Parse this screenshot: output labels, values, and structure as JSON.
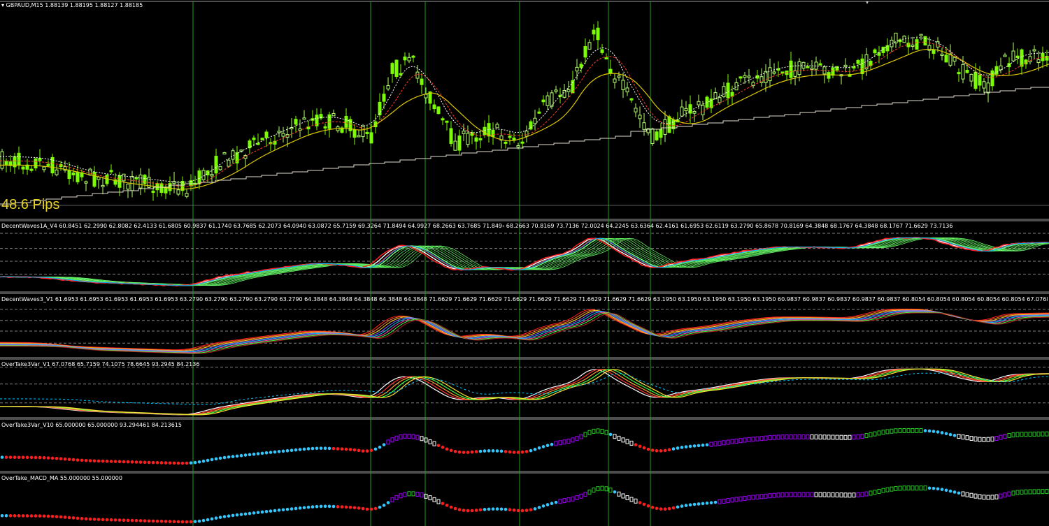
{
  "window": {
    "symbol_header": "▾ GBPAUD,M15  1.88139 1.88195 1.88127 1.88185",
    "pips_label": "48.6 Pips",
    "collapse_icon": "▾"
  },
  "indicators": [
    {
      "id": "dw1a",
      "label": "DecentWaves1A_V4 60.8451 62.2990 62.8082 62.4133 61.6805 60.9837 61.1740 63.7685 62.2073 64.0940 63.0872 65.7159 69.3264 71.8494 64.9927 68.2663 63.7685 71.849‹ 68.2663 70.8169 73.7136 72.0024 64.2245 63.6364 62.4161 61.6953 62.6119 63.2790 65.8678 70.8169 64.3848 68.1767 64.3848 68.1767 71.6629 73.7136"
    },
    {
      "id": "dw3",
      "label": "DecentWaves3_V1 61.6953 61.6953 61.6953 61.6953 61.6953 63.2790 63.2790 63.2790 63.2790 63.2790 64.3848 64.3848 64.3848 64.3848 64.3848 71.6629 71.6629 71.6629 71.6629 71.6629 71.6629 71.6629 71.6629 71.6629 63.1950 63.1950 63.1950 63.1950 63.1950 60.9837 60.9837 60.9837 60.9837 60.9837 60.8054 60.8054 60.8054 60.8054 60.8054 67.0768 67.0768 67.0768 67.0768 67.0768 67.07"
    },
    {
      "id": "ot3v1",
      "label": "OverTake3Var_V1 67.0768 65.7159 74.1075 78.6645 93.2945 84.2136"
    },
    {
      "id": "ot3v10",
      "label": "OverTake3Var_V10 65.000000 65.000000 93.294461 84.213615"
    },
    {
      "id": "otmacd",
      "label": "OverTake_MACD_MA 55.000000 55.000000"
    }
  ],
  "colors": {
    "background": "#000000",
    "bull_candle": "#7cfc00",
    "bear_candle": "#b4ff6e",
    "grid_vertical": "#1ea01e",
    "separator": "#9a9a9a",
    "level_dotted": "#808080",
    "ma_red": "#ff3c28",
    "ma_white": "#ffffff",
    "ma_yellow": "#dcc800",
    "step_line": "#e0dccc",
    "pips_text": "#e6d21e",
    "dot_cyan": "#32c8ff",
    "dot_red": "#ff1e1e",
    "dot_purple": "#a000ff",
    "dot_green": "#28c828",
    "dot_white": "#ffffff"
  },
  "chart_data": {
    "type": "candlestick_with_oscillators",
    "price_header_values": {
      "open": 1.88139,
      "high": 1.88195,
      "low": 1.88127,
      "close": 1.88185
    },
    "vertical_markers_count": 7,
    "oscillator_panels": 4,
    "dot_histogram_panels": 2
  }
}
